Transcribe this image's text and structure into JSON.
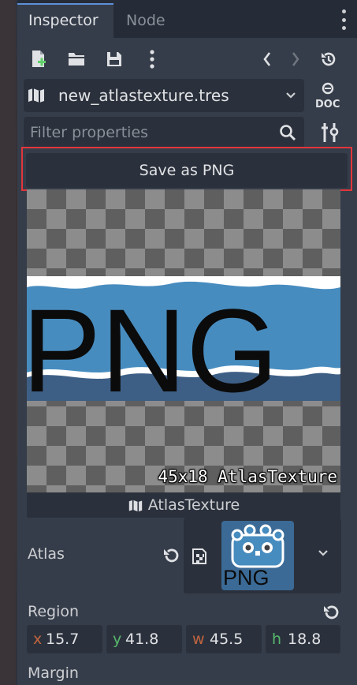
{
  "tabs": [
    {
      "label": "Inspector",
      "active": true
    },
    {
      "label": "Node",
      "active": false
    }
  ],
  "toolbar": {
    "icons": [
      "new-resource-icon",
      "open-folder-icon",
      "save-icon",
      "more-icon",
      "history-back-icon",
      "history-forward-icon",
      "object-history-icon"
    ]
  },
  "resource": {
    "icon": "atlas-map-icon",
    "name": "new_atlastexture.tres",
    "doc_icon": "doc-icon"
  },
  "filter": {
    "placeholder": "Filter properties"
  },
  "save_button": {
    "label": "Save as PNG",
    "highlight_color": "#e2363c"
  },
  "preview": {
    "size_label": "45x18 AtlasTexture",
    "texture_text": "PNG",
    "type_label": "AtlasTexture"
  },
  "atlas": {
    "label": "Atlas",
    "thumbnail_text": "PNG"
  },
  "region": {
    "label": "Region",
    "fields": [
      {
        "axis": "x",
        "value": "15.7",
        "color": "#c2653e"
      },
      {
        "axis": "y",
        "value": "41.8",
        "color": "#56b86c"
      },
      {
        "axis": "w",
        "value": "45.5",
        "color": "#c2653e"
      },
      {
        "axis": "h",
        "value": "18.8",
        "color": "#56b86c"
      }
    ]
  },
  "margin": {
    "label": "Margin"
  },
  "colors": {
    "panel_bg": "#363d4a",
    "tabbar_bg": "#262c37",
    "field_bg": "#2b313c",
    "accent": "#5e8fd8",
    "godot_blue": "#478cbf"
  }
}
